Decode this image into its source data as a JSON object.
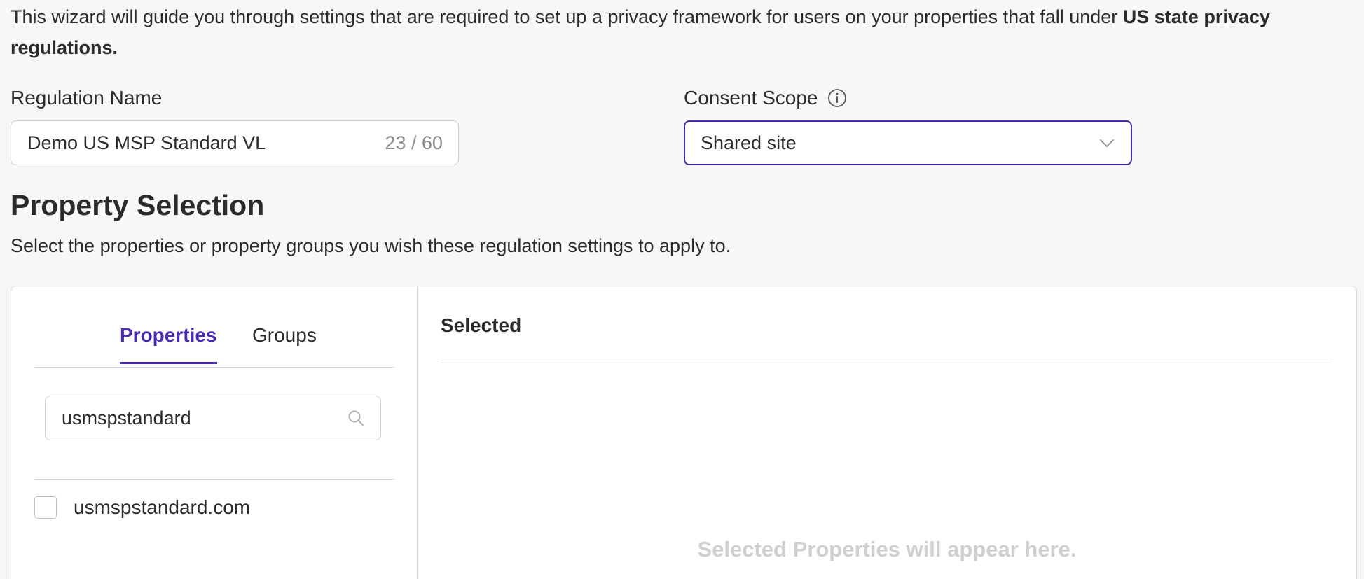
{
  "intro": {
    "text": "This wizard will guide you through settings that are required to set up a privacy framework for users on your properties that fall under ",
    "bold": "US state privacy regulations."
  },
  "regulation_name": {
    "label": "Regulation Name",
    "value": "Demo US MSP Standard VL",
    "counter": "23 / 60"
  },
  "consent_scope": {
    "label": "Consent Scope",
    "selected": "Shared site"
  },
  "property_selection": {
    "title": "Property Selection",
    "description": "Select the properties or property groups you wish these regulation settings to apply to."
  },
  "tabs": [
    {
      "label": "Properties",
      "active": true
    },
    {
      "label": "Groups",
      "active": false
    }
  ],
  "search": {
    "value": "usmspstandard"
  },
  "list": [
    {
      "label": "usmspstandard.com",
      "checked": false
    }
  ],
  "selected_panel": {
    "title": "Selected",
    "empty_text": "Selected Properties will appear here."
  },
  "colors": {
    "accent": "#4a2ab5",
    "border": "#d9d9d9",
    "placeholder": "#cfcfcf"
  },
  "icons": [
    "info-icon",
    "chevron-down-icon",
    "search-icon"
  ]
}
